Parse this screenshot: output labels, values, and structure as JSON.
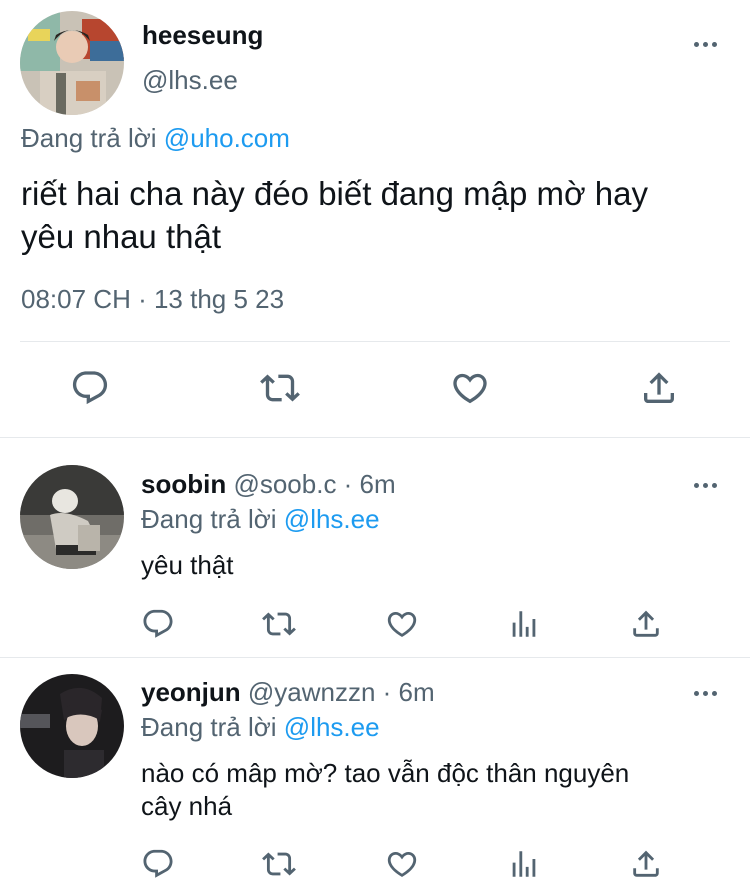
{
  "main_tweet": {
    "display_name": "heeseung",
    "handle": "@lhs.ee",
    "reply_label": "Đang trả lời",
    "reply_to": "@uho.com",
    "text_line1": "riết hai cha này đéo biết đang mập mờ hay",
    "text_line2": "yêu nhau thật",
    "timestamp": "08:07 CH · 13 thg 5 23"
  },
  "replies": [
    {
      "display_name": "soobin",
      "meta": "@soob.c · 6m",
      "reply_label": "Đang trả lời",
      "reply_to": "@lhs.ee",
      "text_line1": "yêu thật",
      "text_line2": ""
    },
    {
      "display_name": "yeonjun",
      "meta": "@yawnzzn · 6m",
      "reply_label": "Đang trả lời",
      "reply_to": "@lhs.ee",
      "text_line1": "nào có mâp mờ? tao vẫn độc thân nguyên",
      "text_line2": "cây nhá"
    }
  ],
  "icons": {
    "reply": "reply-icon",
    "retweet": "retweet-icon",
    "like": "heart-icon",
    "views": "views-icon",
    "share": "share-icon",
    "more": "more-icon"
  },
  "colors": {
    "text": "#0f1419",
    "secondary": "#536471",
    "link": "#1d9bf0",
    "divider": "#e6e9ec"
  }
}
